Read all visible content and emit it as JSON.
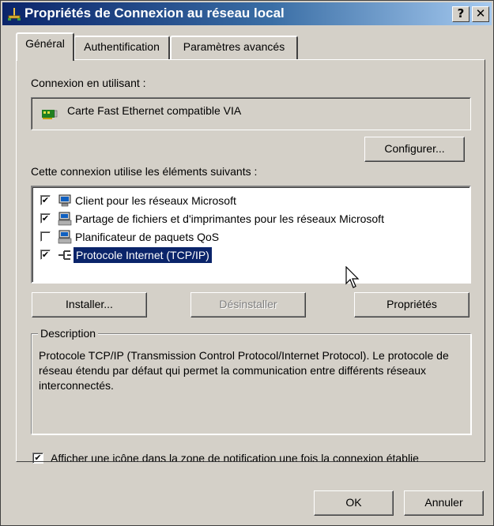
{
  "window": {
    "title": "Propriétés de Connexion au réseau local"
  },
  "titlebar": {
    "help_glyph": "?",
    "close_glyph": "✕"
  },
  "tabs": [
    {
      "label": "Général",
      "active": true
    },
    {
      "label": "Authentification",
      "active": false
    },
    {
      "label": "Paramètres avancés",
      "active": false
    }
  ],
  "general": {
    "connect_using_label": "Connexion en utilisant :",
    "adapter_name": "Carte Fast Ethernet compatible VIA",
    "configure_button": "Configurer...",
    "items_label": "Cette connexion utilise les éléments suivants :",
    "components": [
      {
        "label": "Client pour les réseaux Microsoft",
        "checked": true,
        "icon": "network-client-icon"
      },
      {
        "label": "Partage de fichiers et d'imprimantes pour les réseaux Microsoft",
        "checked": true,
        "icon": "file-share-icon"
      },
      {
        "label": "Planificateur de paquets QoS",
        "checked": false,
        "icon": "qos-scheduler-icon"
      },
      {
        "label": "Protocole Internet (TCP/IP)",
        "checked": true,
        "selected": true,
        "icon": "protocol-icon"
      }
    ],
    "install_button": "Installer...",
    "uninstall_button": "Désinstaller",
    "properties_button": "Propriétés",
    "description_legend": "Description",
    "description_text": "Protocole TCP/IP (Transmission Control Protocol/Internet Protocol). Le protocole de réseau étendu par défaut qui permet la communication entre différents réseaux interconnectés.",
    "notify_label": "Afficher une icône dans la zone de notification une fois la connexion établie",
    "notify_checked": true,
    "check_glyph": "✔"
  },
  "footer": {
    "ok_button": "OK",
    "cancel_button": "Annuler"
  }
}
